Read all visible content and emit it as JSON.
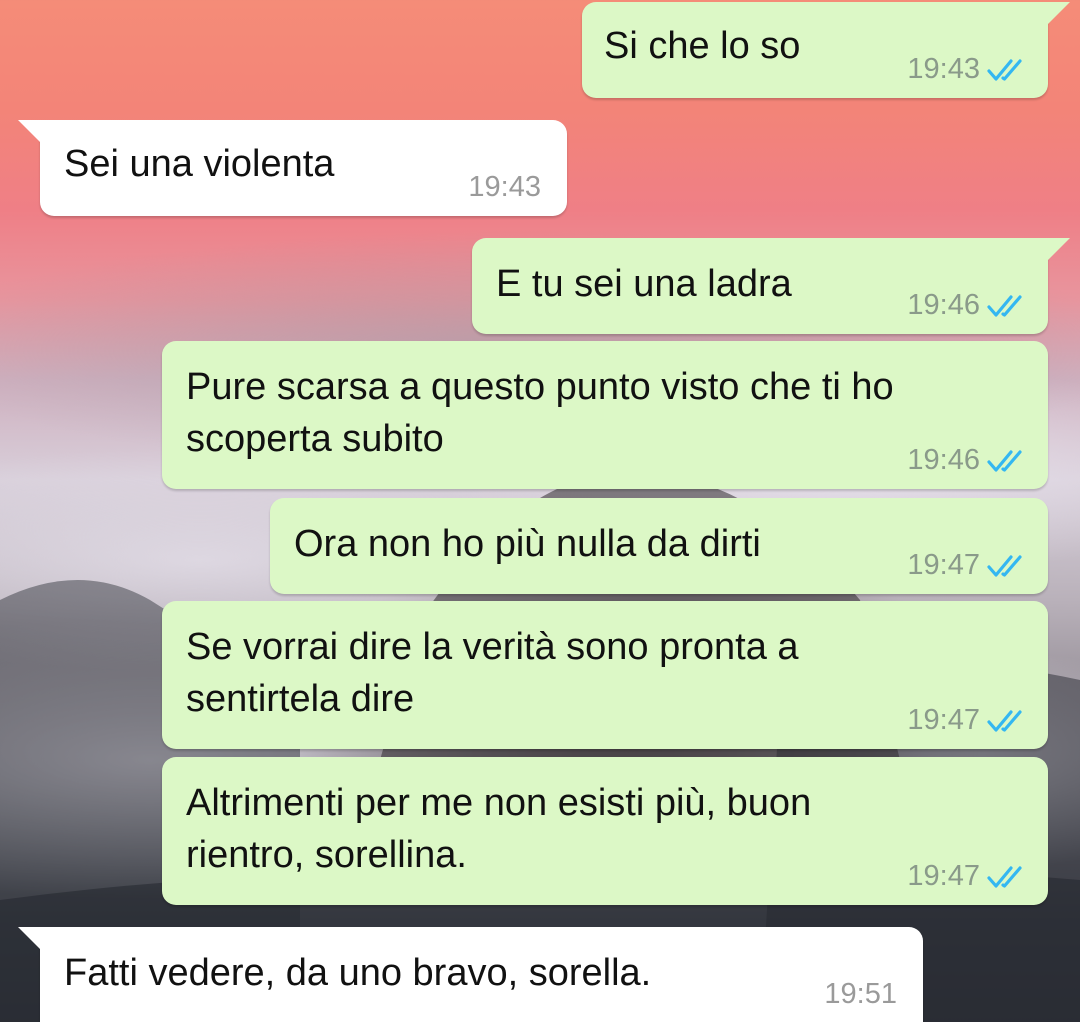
{
  "colors": {
    "outgoing_bubble": "#dcf8c6",
    "incoming_bubble": "#ffffff",
    "read_ticks": "#34b7f1"
  },
  "messages": [
    {
      "direction": "outgoing",
      "text": "Si che lo so",
      "time": "19:43",
      "status": "read"
    },
    {
      "direction": "incoming",
      "text": "Sei una violenta",
      "time": "19:43"
    },
    {
      "direction": "outgoing",
      "text": "E tu sei una ladra",
      "time": "19:46",
      "status": "read"
    },
    {
      "direction": "outgoing",
      "text": "Pure scarsa a questo punto visto che ti ho\nscoperta subito",
      "time": "19:46",
      "status": "read"
    },
    {
      "direction": "outgoing",
      "text": "Ora non ho più nulla da dirti",
      "time": "19:47",
      "status": "read"
    },
    {
      "direction": "outgoing",
      "text": "Se vorrai dire la verità sono pronta a\nsentirtela dire",
      "time": "19:47",
      "status": "read"
    },
    {
      "direction": "outgoing",
      "text": "Altrimenti per me non esisti più, buon\nrientro, sorellina.",
      "time": "19:47",
      "status": "read"
    },
    {
      "direction": "incoming",
      "text": "Fatti vedere, da uno bravo, sorella.",
      "time": "19:51"
    }
  ]
}
